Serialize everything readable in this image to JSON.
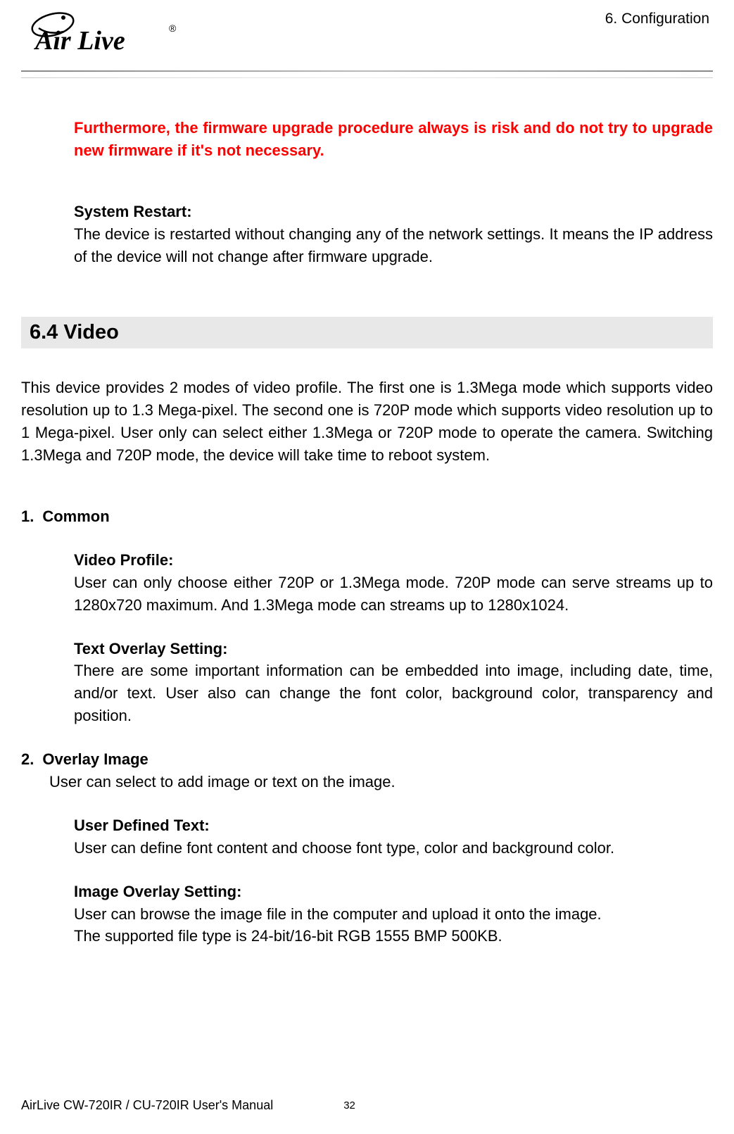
{
  "header": {
    "logo_text": "Air Live",
    "chapter": "6.  Configuration"
  },
  "warning_text": "Furthermore, the firmware upgrade procedure always is risk and do not try to upgrade new firmware if it's not necessary.",
  "system_restart": {
    "label": "System Restart:",
    "body": "The device is restarted without changing any of the network settings. It means the IP address of the device will not change after firmware upgrade."
  },
  "section_heading": "6.4 Video",
  "intro": "This device provides 2 modes of video profile. The first one is 1.3Mega mode which supports video resolution up to 1.3 Mega-pixel. The second one is 720P mode which supports video resolution up to 1 Mega-pixel. User only can select either 1.3Mega or 720P mode to operate the camera. Switching 1.3Mega and 720P mode, the device will take time to reboot system.",
  "item1": {
    "number": "1.",
    "title": "Common",
    "video_profile": {
      "label": "Video Profile:",
      "body": "User can only choose either 720P or 1.3Mega mode. 720P mode can serve streams up to 1280x720 maximum. And 1.3Mega mode can streams up to 1280x1024."
    },
    "text_overlay": {
      "label": "Text Overlay Setting:",
      "body": "There are some important information can be embedded into image, including date, time, and/or text. User also can change the font color, background color, transparency and position."
    }
  },
  "item2": {
    "number": "2.",
    "title": "Overlay Image",
    "intro": "User can select to add image or text on the image.",
    "user_defined": {
      "label": "User Defined Text:",
      "body": "User can define font content and choose font type, color and background color."
    },
    "image_overlay": {
      "label": "Image Overlay Setting:",
      "body1": "User can browse the image file in the computer and upload it onto the image.",
      "body2": "The supported file type is 24-bit/16-bit RGB 1555 BMP 500KB."
    }
  },
  "footer": {
    "title": "AirLive CW-720IR / CU-720IR User's Manual",
    "page": "32"
  }
}
